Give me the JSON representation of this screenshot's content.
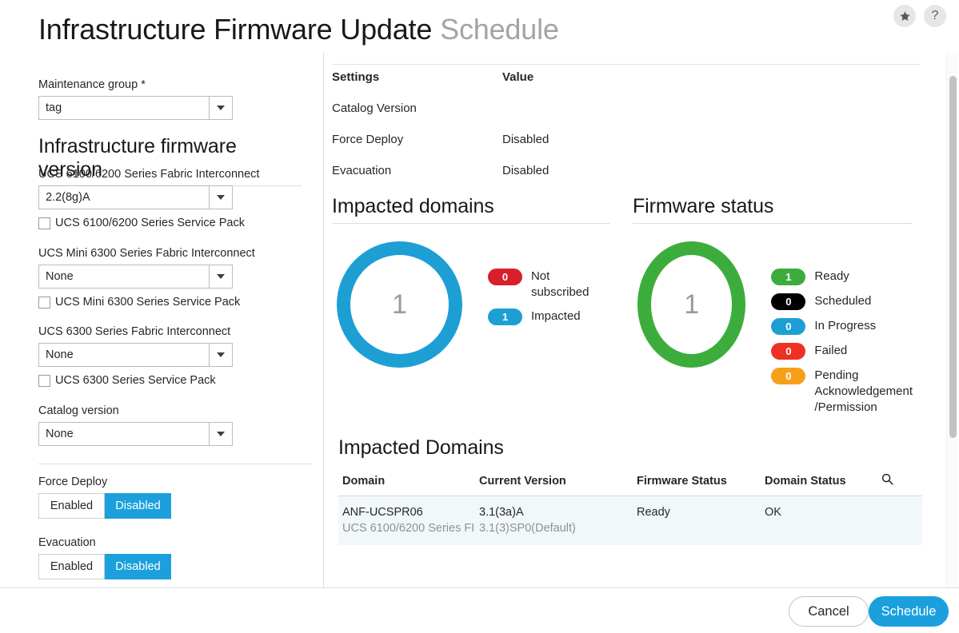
{
  "header": {
    "title_main": "Infrastructure Firmware Update",
    "title_sub": "Schedule",
    "favorite_icon": "star-icon",
    "help_label": "?"
  },
  "left_panel": {
    "maintenance_group": {
      "label": "Maintenance group",
      "required_mark": "*",
      "value": "tag"
    },
    "firmware_version_section": {
      "heading": "Infrastructure firmware version",
      "fields": [
        {
          "label": "UCS 6100/6200 Series Fabric Interconnect",
          "value": "2.2(8g)A",
          "checkbox_label": "UCS 6100/6200 Series Service Pack",
          "checked": false
        },
        {
          "label": "UCS Mini 6300 Series Fabric Interconnect",
          "value": "None",
          "checkbox_label": "UCS Mini 6300 Series Service Pack",
          "checked": false
        },
        {
          "label": "UCS 6300 Series Fabric Interconnect",
          "value": "None",
          "checkbox_label": "UCS 6300 Series Service Pack",
          "checked": false
        }
      ],
      "catalog": {
        "label": "Catalog version",
        "value": "None"
      }
    },
    "force_deploy": {
      "label": "Force Deploy",
      "option_on": "Enabled",
      "option_off": "Disabled",
      "selected": "Disabled"
    },
    "evacuation": {
      "label": "Evacuation",
      "option_on": "Enabled",
      "option_off": "Disabled",
      "selected": "Disabled"
    }
  },
  "right_panel": {
    "settings_table": {
      "header": {
        "setting": "Settings",
        "value": "Value"
      },
      "rows": [
        {
          "setting": "Catalog Version",
          "value": ""
        },
        {
          "setting": "Force Deploy",
          "value": "Disabled"
        },
        {
          "setting": "Evacuation",
          "value": "Disabled"
        }
      ]
    },
    "impacted_domains_chart": {
      "heading": "Impacted domains",
      "center_value": "1",
      "ring_color": "#1d9fd4",
      "legend": [
        {
          "count": "0",
          "label": "Not subscribed",
          "color": "#d81f2a"
        },
        {
          "count": "1",
          "label": "Impacted",
          "color": "#1d9fd4"
        }
      ]
    },
    "firmware_status_chart": {
      "heading": "Firmware status",
      "center_value": "1",
      "ring_color": "#3cad3c",
      "legend": [
        {
          "count": "1",
          "label": "Ready",
          "color": "#3cad3c"
        },
        {
          "count": "0",
          "label": "Scheduled",
          "color": "#000000"
        },
        {
          "count": "0",
          "label": "In Progress",
          "color": "#1d9fd4"
        },
        {
          "count": "0",
          "label": "Failed",
          "color": "#ee3124"
        },
        {
          "count": "0",
          "label": "Pending Acknowledgement /Permission",
          "color": "#f6a01a"
        }
      ]
    },
    "impacted_domains_table": {
      "heading": "Impacted Domains",
      "search_icon": "search-icon",
      "columns": [
        "Domain",
        "Current Version",
        "Firmware Status",
        "Domain Status"
      ],
      "rows": [
        {
          "domain": "ANF-UCSPR06",
          "domain_sub": "UCS 6100/6200 Series FI",
          "current_version": "3.1(3a)A",
          "current_version_sub": "3.1(3)SP0(Default)",
          "firmware_status": "Ready",
          "domain_status": "OK"
        }
      ]
    }
  },
  "footer": {
    "cancel_label": "Cancel",
    "schedule_label": "Schedule"
  },
  "chart_data": [
    {
      "type": "pie",
      "title": "Impacted domains",
      "categories": [
        "Not subscribed",
        "Impacted"
      ],
      "values": [
        0,
        1
      ],
      "colors": [
        "#d81f2a",
        "#1d9fd4"
      ],
      "total": 1,
      "legend": "right"
    },
    {
      "type": "pie",
      "title": "Firmware status",
      "categories": [
        "Ready",
        "Scheduled",
        "In Progress",
        "Failed",
        "Pending Acknowledgement /Permission"
      ],
      "values": [
        1,
        0,
        0,
        0,
        0
      ],
      "colors": [
        "#3cad3c",
        "#000000",
        "#1d9fd4",
        "#ee3124",
        "#f6a01a"
      ],
      "total": 1,
      "legend": "right"
    }
  ]
}
